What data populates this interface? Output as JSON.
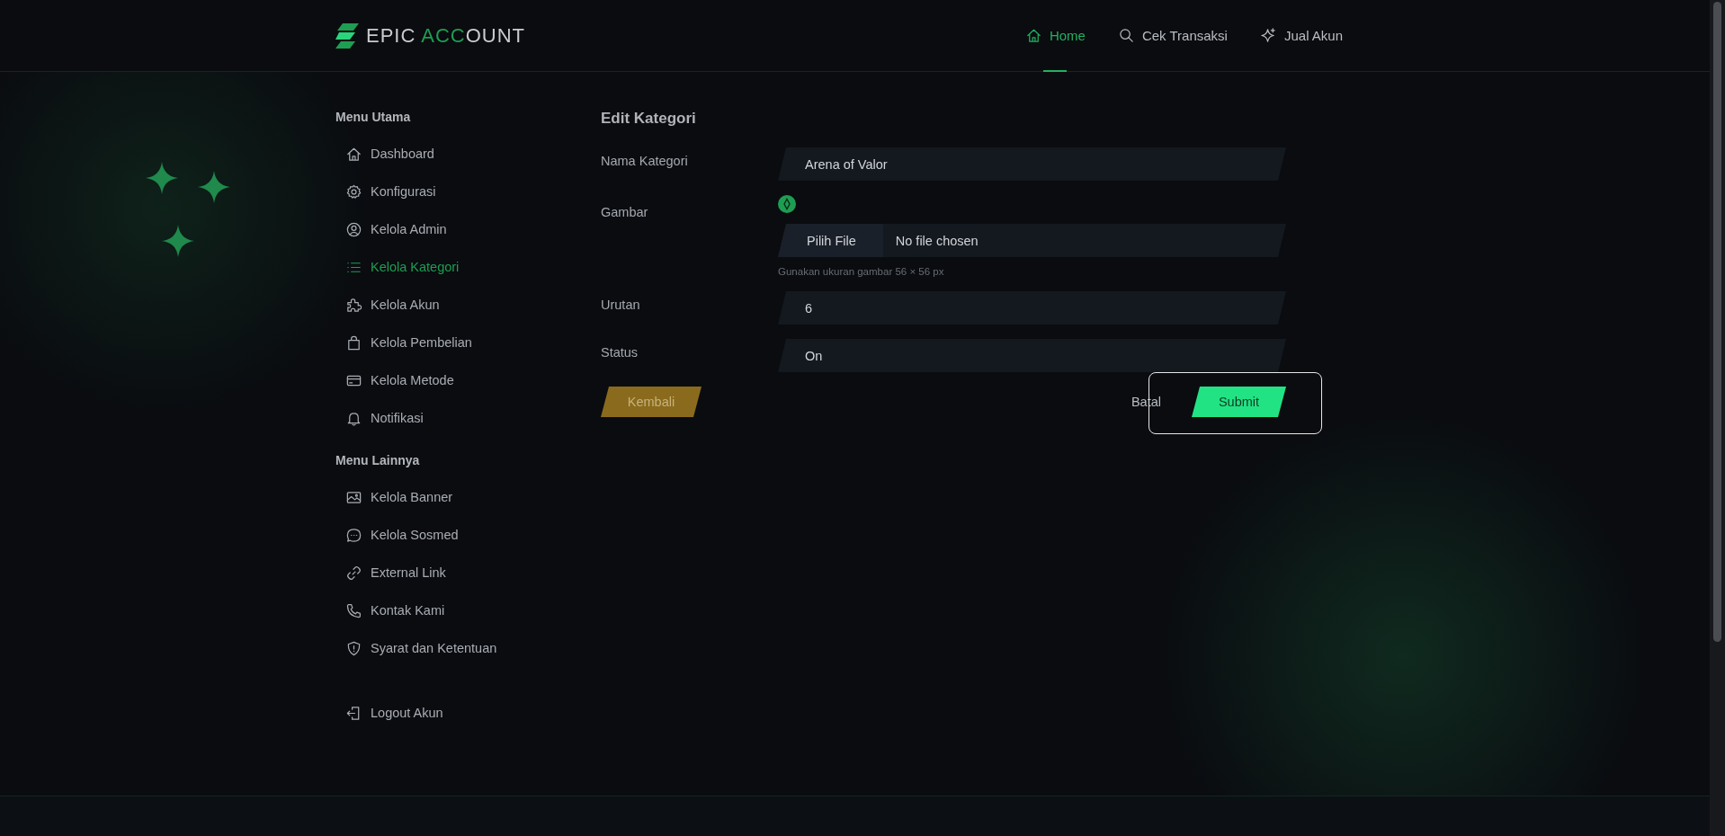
{
  "header": {
    "logo": {
      "part_1": "EPIC ",
      "part_2": "ACC",
      "part_3": "OUNT"
    },
    "nav": [
      {
        "kind": "home",
        "label": "Home",
        "selected": true
      },
      {
        "kind": "search",
        "label": "Cek Transaksi",
        "selected": false
      },
      {
        "kind": "sparkle",
        "label": "Jual Akun",
        "selected": false
      }
    ]
  },
  "sidebar": {
    "sections": [
      {
        "title": "Menu Utama",
        "items": [
          {
            "kind": "home",
            "label": "Dashboard",
            "selected": false
          },
          {
            "kind": "gear",
            "label": "Konfigurasi",
            "selected": false
          },
          {
            "kind": "user",
            "label": "Kelola Admin",
            "selected": false
          },
          {
            "kind": "list",
            "label": "Kelola Kategori",
            "selected": true
          },
          {
            "kind": "puzzle",
            "label": "Kelola Akun",
            "selected": false
          },
          {
            "kind": "bag",
            "label": "Kelola Pembelian",
            "selected": false
          },
          {
            "kind": "card",
            "label": "Kelola Metode",
            "selected": false
          },
          {
            "kind": "bell",
            "label": "Notifikasi",
            "selected": false
          }
        ]
      },
      {
        "title": "Menu Lainnya",
        "items": [
          {
            "kind": "image",
            "label": "Kelola Banner",
            "selected": false
          },
          {
            "kind": "chat",
            "label": "Kelola Sosmed",
            "selected": false
          },
          {
            "kind": "link",
            "label": "External Link",
            "selected": false
          },
          {
            "kind": "phone",
            "label": "Kontak Kami",
            "selected": false
          },
          {
            "kind": "shield",
            "label": "Syarat dan Ketentuan",
            "selected": false
          }
        ]
      }
    ],
    "logout": {
      "label": "Logout Akun"
    }
  },
  "form": {
    "title": "Edit Kategori",
    "fields": [
      {
        "kind": "text",
        "label": "Nama Kategori",
        "value": "Arena of Valor"
      },
      {
        "kind": "file",
        "label": "Gambar",
        "button": "Pilih File",
        "file_name": "No file chosen",
        "hint": "Gunakan ukuran gambar 56 × 56 px"
      },
      {
        "kind": "text",
        "label": "Urutan",
        "value": "6"
      },
      {
        "kind": "text",
        "label": "Status",
        "value": "On"
      }
    ],
    "back_button": "Kembali",
    "cancel_button": "Batal",
    "submit_button": "Submit"
  }
}
